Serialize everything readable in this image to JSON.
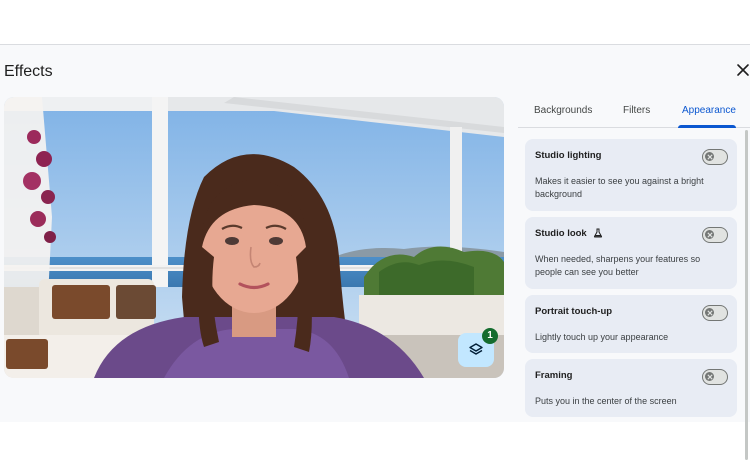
{
  "dialog": {
    "title": "Effects",
    "close_icon": "close-icon"
  },
  "preview": {
    "badge_count": "1",
    "layers_icon": "layers-icon"
  },
  "tabs": [
    {
      "label": "Backgrounds",
      "active": false
    },
    {
      "label": "Filters",
      "active": false
    },
    {
      "label": "Appearance",
      "active": true
    }
  ],
  "cards": [
    {
      "title": "Studio lighting",
      "description": "Makes it easier to see you against a bright background",
      "enabled": false
    },
    {
      "title": "Studio look",
      "description": "When needed, sharpens your features so people can see you better",
      "enabled": false,
      "icon": "flask-icon"
    },
    {
      "title": "Portrait touch-up",
      "description": "Lightly touch up your appearance",
      "enabled": false
    },
    {
      "title": "Framing",
      "description": "Puts you in the center of the screen",
      "enabled": false
    }
  ],
  "colors": {
    "accent": "#0b57d0",
    "card_bg": "#e8ecf4",
    "badge": "#146c2e",
    "layers_button": "#c2e7ff"
  }
}
